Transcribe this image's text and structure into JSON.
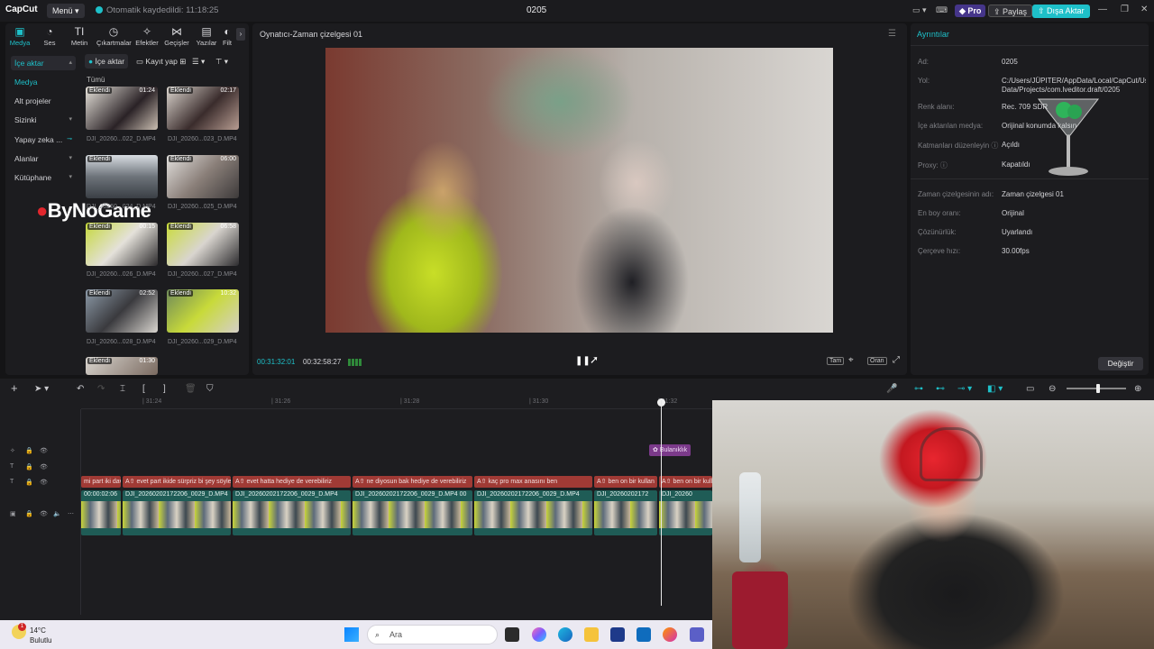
{
  "titlebar": {
    "logo": "CapCut",
    "menu": "Menü",
    "autosave": "Otomatik kaydedildi: 11:18:25",
    "project_title": "0205",
    "pro": "Pro",
    "share": "Paylaş",
    "export": "Dışa Aktar"
  },
  "leftpanel": {
    "tabs": [
      "Medya",
      "Ses",
      "Metin",
      "Çıkartmalar",
      "Efektler",
      "Geçişler",
      "Yazılar",
      "Filt"
    ],
    "nav": [
      "İçe aktar",
      "Medya",
      "Alt projeler",
      "Sizinki",
      "Yapay zeka ...",
      "Alanlar",
      "Kütüphane"
    ],
    "import_btn": "İçe aktar",
    "record_btn": "Kayıt yap",
    "all_label": "Tümü",
    "watermark": "ByNoGame",
    "media": [
      {
        "tag": "Eklendi",
        "dur": "01:24",
        "name": "DJI_20260...022_D.MP4"
      },
      {
        "tag": "Eklendi",
        "dur": "02:17",
        "name": "DJI_20260...023_D.MP4"
      },
      {
        "tag": "Eklendi",
        "dur": "",
        "name": "DJI_20260...024_D.MP4"
      },
      {
        "tag": "Eklendi",
        "dur": "06:00",
        "name": "DJI_20260...025_D.MP4"
      },
      {
        "tag": "Eklendi",
        "dur": "00:15",
        "name": "DJI_20260...026_D.MP4"
      },
      {
        "tag": "Eklendi",
        "dur": "06:58",
        "name": "DJI_20260...027_D.MP4"
      },
      {
        "tag": "Eklendi",
        "dur": "02:52",
        "name": "DJI_20260...028_D.MP4"
      },
      {
        "tag": "Eklendi",
        "dur": "10:32",
        "name": "DJI_20260...029_D.MP4"
      },
      {
        "tag": "Eklendi",
        "dur": "01:30",
        "name": ""
      }
    ]
  },
  "player": {
    "title": "Oynatıcı-Zaman çizelgesi 01",
    "current_time": "00:31:32:01",
    "total_time": "00:32:58:27",
    "full_btn": "Tam",
    "ratio_btn": "Oran"
  },
  "details": {
    "header": "Ayrıntılar",
    "rows": [
      {
        "label": "Ad:",
        "value": "0205"
      },
      {
        "label": "Yol:",
        "value": "C:/Users/JÜPITER/AppData/Local/CapCut/User Data/Projects/com.lveditor.draft/0205"
      },
      {
        "label": "Renk alanı:",
        "value": "Rec. 709 SDR"
      },
      {
        "label": "İçe aktarılan medya:",
        "value": "Orijinal konumda kalsın"
      },
      {
        "label": "Katmanları düzenleyin",
        "value": "Açıldı"
      },
      {
        "label": "Proxy:",
        "value": "Kapatıldı"
      },
      {
        "label": "Zaman çizelgesinin adı:",
        "value": "Zaman çizelgesi 01"
      },
      {
        "label": "En boy oranı:",
        "value": "Orijinal"
      },
      {
        "label": "Çözünürlük:",
        "value": "Uyarlandı"
      },
      {
        "label": "Çerçeve hızı:",
        "value": "30.00fps"
      }
    ],
    "change_btn": "Değiştir"
  },
  "timeline": {
    "ruler": [
      "| 31:24",
      "| 31:26",
      "| 31:28",
      "| 31:30",
      "| 31:32"
    ],
    "effect": "Bulanıklık",
    "text_clips": [
      "mi part iki dave",
      "A⇧ evet part ikide sürpriz bi şey söyle",
      "A⇧ evet hatta hediye de verebiliriz",
      "A⇧ ne diyosun bak hediye de verebiliriz",
      "A⇧ kaç pro max anasını ben",
      "A⇧ ben on bir kullan",
      "A⇧ ben on bir kulla"
    ],
    "video_clips": [
      "00:00:02:06",
      "DJI_20260202172206_0029_D.MP4",
      "DJI_20260202172206_0029_D.MP4",
      "DJI_20260202172206_0029_D.MP4  00",
      "DJI_20260202172206_0029_D.MP4",
      "DJI_20260202172",
      "DJI_20260"
    ]
  },
  "taskbar": {
    "temp": "14°C",
    "weather": "Bulutlu",
    "search": "Ara"
  }
}
